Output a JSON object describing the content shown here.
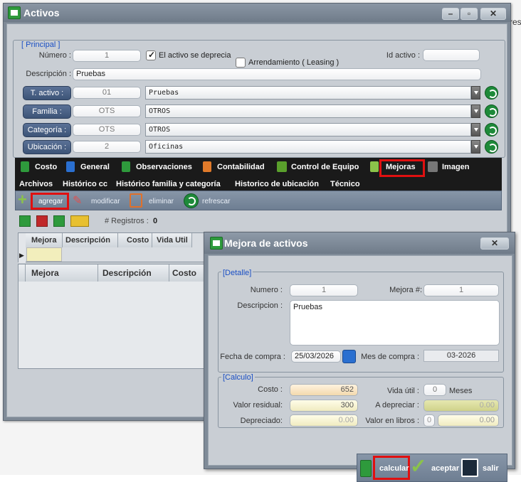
{
  "background_text": "res",
  "main_window": {
    "title": "Activos",
    "principal": {
      "legend": "[ Principal ]",
      "numero_label": "Número :",
      "numero_value": "1",
      "depreciation_label": "El activo se deprecia",
      "depreciation_checked": true,
      "leasing_label": "Arrendamiento ( Leasing )",
      "leasing_checked": false,
      "id_activo_label": "Id activo :",
      "id_activo_value": "",
      "descripcion_label": "Descripción :",
      "descripcion_value": "Pruebas",
      "fields": [
        {
          "button": "T. activo :",
          "code": "01",
          "value": "Pruebas"
        },
        {
          "button": "Familia :",
          "code": "OTS",
          "value": "OTROS"
        },
        {
          "button": "Categoría :",
          "code": "OTS",
          "value": "OTROS"
        },
        {
          "button": "Ubicación :",
          "code": "2",
          "value": "Oficinas"
        }
      ]
    },
    "tabs": [
      "Costo",
      "General",
      "Observaciones",
      "Contabilidad",
      "Control de Equipo",
      "Mejoras",
      "Imagen"
    ],
    "active_tab": "Mejoras",
    "subtabs": [
      "Archivos",
      "Histórico cc",
      "Histórico familia y categoría",
      "Historico de ubicación",
      "Técnico"
    ],
    "toolbar": {
      "agregar": "agregar",
      "modificar": "modificar",
      "eliminar": "eliminar",
      "refrescar": "refrescar"
    },
    "registros_label": "# Registros :",
    "registros_count": "0",
    "grid1_headers": [
      "Mejora",
      "Descripción",
      "Costo",
      "Vida Util"
    ],
    "grid2_headers": [
      "Mejora",
      "Descripción",
      "Costo"
    ]
  },
  "dialog": {
    "title": "Mejora de activos",
    "detalle": {
      "legend": "[Detalle]",
      "numero_label": "Numero :",
      "numero_value": "1",
      "mejora_label": "Mejora #:",
      "mejora_value": "1",
      "descripcion_label": "Descripcion :",
      "descripcion_value": "Pruebas",
      "fecha_label": "Fecha de compra :",
      "fecha_value": "25/03/2026",
      "mes_label": "Mes de compra :",
      "mes_value": "03-2026"
    },
    "calculo": {
      "legend": "[Calculo]",
      "costo_label": "Costo :",
      "costo_value": "652",
      "vida_label": "Vida útil :",
      "vida_value": "0",
      "meses_label": "Meses",
      "residual_label": "Valor residual:",
      "residual_value": "300",
      "adepreciar_label": "A depreciar :",
      "adepreciar_value": "0.00",
      "depreciado_label": "Depreciado:",
      "depreciado_value": "0.00",
      "libros_label": "Valor en libros :",
      "libros_small": "0",
      "libros_value": "0.00"
    },
    "buttons": {
      "calcular": "calcular",
      "aceptar": "aceptar",
      "salir": "salir"
    }
  },
  "colors": {
    "highlight": "#e01010",
    "link_blue": "#1a4fc4",
    "icon_green": "#1e8a3a"
  }
}
